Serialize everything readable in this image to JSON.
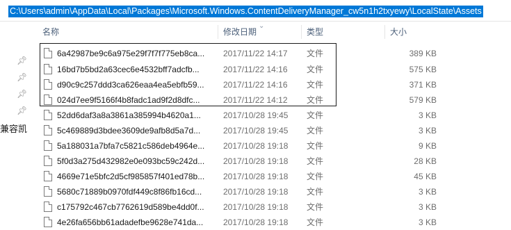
{
  "address_bar": {
    "path": "C:\\Users\\admin\\AppData\\Local\\Packages\\Microsoft.Windows.ContentDeliveryManager_cw5n1h2txyewy\\LocalState\\Assets"
  },
  "columns": {
    "name": "名称",
    "date": "修改日期",
    "type": "类型",
    "size": "大小"
  },
  "left_pane": {
    "truncated_label": "兼容凯"
  },
  "files": [
    {
      "name": "6a42987be9c6a975e29f7f7f775eb8ca...",
      "date": "2017/11/22 14:17",
      "type": "文件",
      "size": "389 KB"
    },
    {
      "name": "16bd7b5bd2a63cec6e4532bff7adcfb...",
      "date": "2017/11/22 14:16",
      "type": "文件",
      "size": "575 KB"
    },
    {
      "name": "d90c9c257ddd3ca626eaa4ea5ebfb59...",
      "date": "2017/11/22 14:16",
      "type": "文件",
      "size": "371 KB"
    },
    {
      "name": "024d7ee9f5166f4b8fadc1ad9f2d8dfc...",
      "date": "2017/11/22 14:12",
      "type": "文件",
      "size": "579 KB"
    },
    {
      "name": "52dd6daf3a8a3861a385994b4620a1...",
      "date": "2017/10/28 19:45",
      "type": "文件",
      "size": "3 KB"
    },
    {
      "name": "5c469889d3bdee3609de9afb8d5a7d...",
      "date": "2017/10/28 19:45",
      "type": "文件",
      "size": "3 KB"
    },
    {
      "name": "5a188031a7bfa7c5821c586deb4964e...",
      "date": "2017/10/28 19:18",
      "type": "文件",
      "size": "9 KB"
    },
    {
      "name": "5f0d3a275d432982e0e093bc59c242d...",
      "date": "2017/10/28 19:18",
      "type": "文件",
      "size": "28 KB"
    },
    {
      "name": "4669e71e5bfc2d5cf985857f401ed78b...",
      "date": "2017/10/28 19:18",
      "type": "文件",
      "size": "45 KB"
    },
    {
      "name": "5680c71889b0970fdf449c8f86fb16cd...",
      "date": "2017/10/28 19:18",
      "type": "文件",
      "size": "3 KB"
    },
    {
      "name": "c175792c467cb7762619d589be4dd0f...",
      "date": "2017/10/28 19:18",
      "type": "文件",
      "size": "3 KB"
    },
    {
      "name": "4e26fa656bb61adadefbe9628e741da...",
      "date": "2017/10/28 19:18",
      "type": "文件",
      "size": "3 KB"
    }
  ]
}
